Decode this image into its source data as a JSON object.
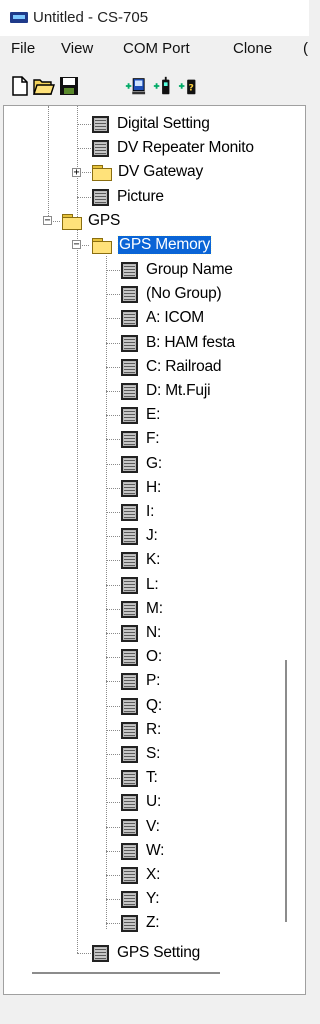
{
  "window": {
    "title": "Untitled - CS-705"
  },
  "menu": [
    "File",
    "View",
    "COM Port",
    "Clone",
    "("
  ],
  "toolbar": {
    "icons": [
      "new-file-icon",
      "open-folder-icon",
      "save-disk-icon",
      "read-from-radio-icon",
      "write-to-radio-icon",
      "radio-info-icon"
    ]
  },
  "tree": {
    "top_items": [
      "Digital Setting",
      "DV Repeater Monito",
      "DV Gateway",
      "Picture"
    ],
    "gps_label": "GPS",
    "gps_memory_label": "GPS Memory",
    "gps_memory_items": [
      "Group Name",
      "(No Group)",
      "A: ICOM",
      "B: HAM festa",
      "C: Railroad",
      "D: Mt.Fuji",
      "E:",
      "F:",
      "G:",
      "H:",
      "I:",
      "J:",
      "K:",
      "L:",
      "M:",
      "N:",
      "O:",
      "P:",
      "Q:",
      "R:",
      "S:",
      "T:",
      "U:",
      "V:",
      "W:",
      "X:",
      "Y:",
      "Z:"
    ],
    "gps_setting_label": "GPS Setting"
  }
}
